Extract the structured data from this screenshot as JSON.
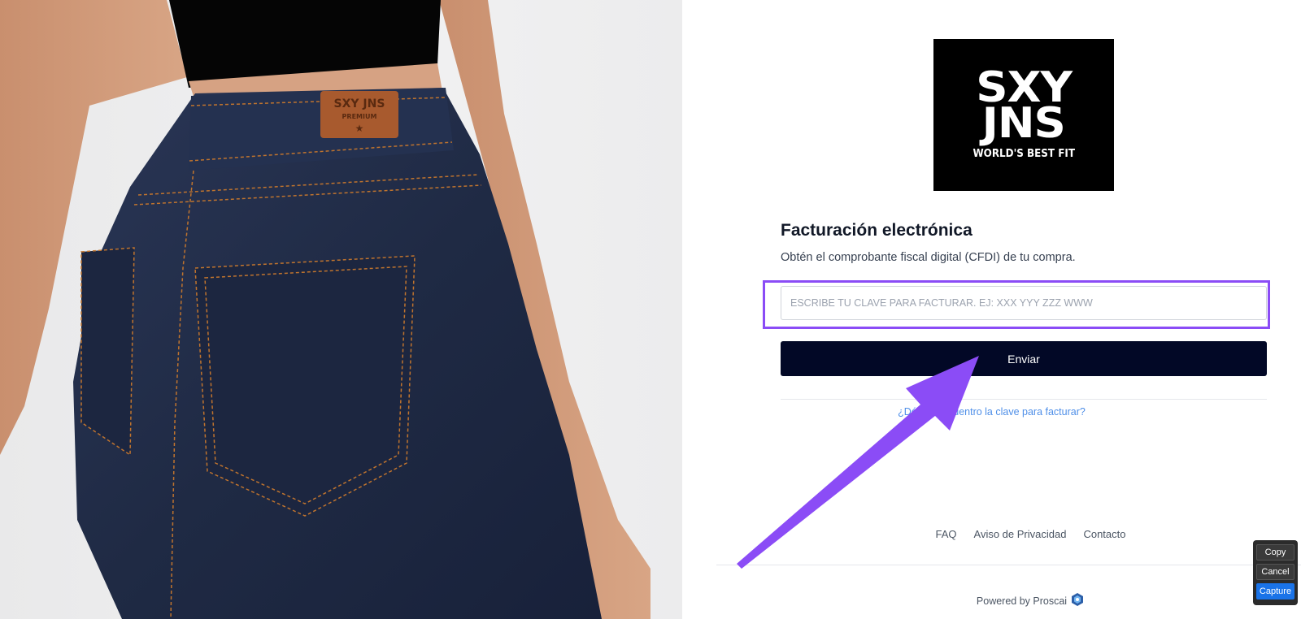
{
  "hero": {
    "label_text": "SXY JNS",
    "label_subtext": "PREMIUM"
  },
  "logo": {
    "line1": "SXY",
    "line2": "JNS",
    "line3": "WORLD'S BEST FIT"
  },
  "form": {
    "title": "Facturación electrónica",
    "subtitle": "Obtén el comprobante fiscal digital (CFDI) de tu compra.",
    "input_placeholder": "ESCRIBE TU CLAVE PARA FACTURAR. EJ: XXX YYY ZZZ WWW",
    "input_value": "",
    "submit_label": "Enviar",
    "help_link": "¿Dónde encuentro la clave para facturar?"
  },
  "footer": {
    "links": [
      "FAQ",
      "Aviso de Privacidad",
      "Contacto"
    ],
    "powered_by": "Powered by Proscai"
  },
  "capture_widget": {
    "copy": "Copy",
    "cancel": "Cancel",
    "capture": "Capture"
  },
  "colors": {
    "accent": "#8b4cf6",
    "button_bg": "#020826",
    "link": "#4f8fe8",
    "denim": "#1f2a44",
    "stitch": "#c0742e"
  },
  "icons": {
    "powered_logo": "proscai-logo-icon",
    "annotation": "arrow-icon"
  }
}
